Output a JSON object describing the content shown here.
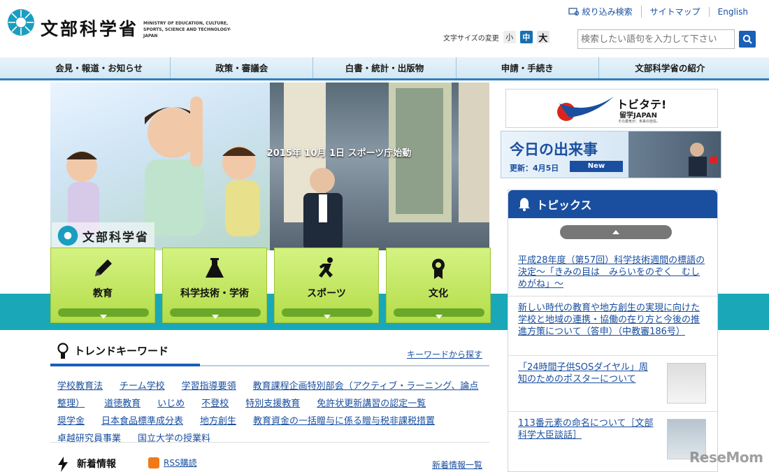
{
  "header": {
    "logo_jp": "文部科学省",
    "logo_en": "MINISTRY OF EDUCATION, CULTURE, SPORTS, SCIENCE AND TECHNOLOGY-JAPAN",
    "utility_links": [
      "絞り込み検索",
      "サイトマップ",
      "English"
    ],
    "font_size_label": "文字サイズの変更",
    "font_sizes": [
      "小",
      "中",
      "大"
    ],
    "search_placeholder": "検索したい語句を入力して下さい"
  },
  "nav": [
    "会見・報道・お知らせ",
    "政策・審議会",
    "白書・統計・出版物",
    "申請・手続き",
    "文部科学省の紹介"
  ],
  "hero": {
    "logo_text": "文部科学省",
    "caption": "2015年 10月 1日 スポーツ庁始動",
    "categories": [
      "教育",
      "科学技術・学術",
      "スポーツ",
      "文化"
    ]
  },
  "trend": {
    "title": "トレンドキーワード",
    "link": "キーワードから探す",
    "keywords": [
      "学校教育法",
      "チーム学校",
      "学習指導要領",
      "教育課程企画特別部会（アクティブ・ラーニング、論点整理）",
      "道徳教育",
      "いじめ",
      "不登校",
      "特別支援教育",
      "免許状更新講習の認定一覧",
      "奨学金",
      "日本食品標準成分表",
      "地方創生",
      "教育資金の一括贈与に係る贈与税非課税措置",
      "卓越研究員事業",
      "国立大学の授業料"
    ]
  },
  "news": {
    "title": "新着情報",
    "rss": "RSS購読",
    "link": "新着情報一覧"
  },
  "banners": {
    "tobitate_title": "トビタテ!",
    "tobitate_sub": "留学JAPAN",
    "tobitate_tiny": "その勇気が、未来の自信。",
    "today_title": "今日の出来事",
    "today_date": "更新：4月5日",
    "today_new": "New"
  },
  "topics": {
    "title": "トピックス",
    "items": [
      "平成28年度（第57回）科学技術週間の標語の決定～「きみの目は　みらいをのぞく　むしめがね」～",
      "新しい時代の教育や地方創生の実現に向けた学校と地域の連携・協働の在り方と今後の推進方策について（答申）（中教審186号）",
      "「24時間子供SOSダイヤル」周知のためのポスターについて",
      "113番元素の命名について［文部科学大臣談話］"
    ]
  },
  "watermark": "ReseMom"
}
